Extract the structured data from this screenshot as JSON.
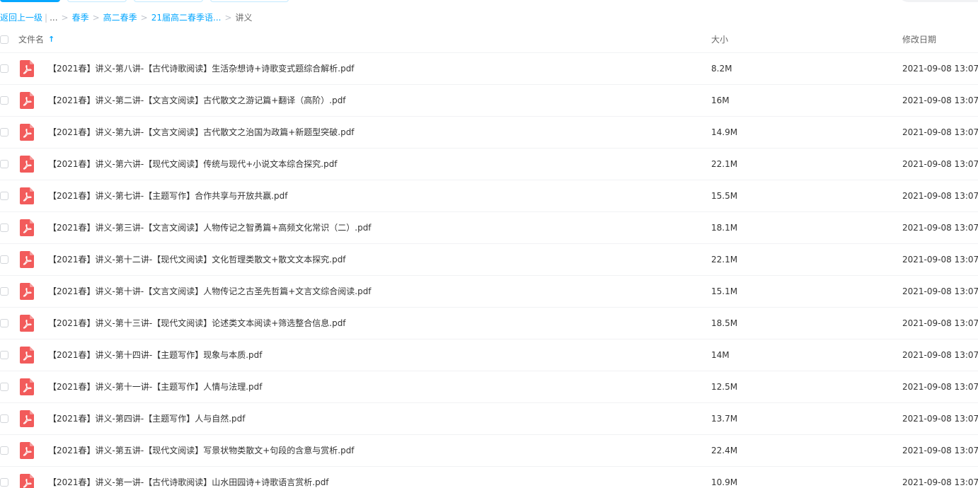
{
  "breadcrumb": {
    "back": "返回上一级",
    "ellipsis": "...",
    "items": [
      "春季",
      "高二春季",
      "21届高二春季语..."
    ],
    "current": "讲义"
  },
  "header": {
    "name": "文件名",
    "size": "大小",
    "date": "修改日期"
  },
  "colors": {
    "accent": "#06a7ff",
    "pdf_red": "#f25b5b"
  },
  "files": [
    {
      "name": "【2021春】讲义-第八讲-【古代诗歌阅读】生活杂想诗+诗歌变式题综合解析.pdf",
      "size": "8.2M",
      "date": "2021-09-08 13:07"
    },
    {
      "name": "【2021春】讲义-第二讲-【文言文阅读】古代散文之游记篇+翻译（高阶）.pdf",
      "size": "16M",
      "date": "2021-09-08 13:07"
    },
    {
      "name": "【2021春】讲义-第九讲-【文言文阅读】古代散文之治国为政篇+新题型突破.pdf",
      "size": "14.9M",
      "date": "2021-09-08 13:07"
    },
    {
      "name": "【2021春】讲义-第六讲-【现代文阅读】传统与现代+小说文本综合探究.pdf",
      "size": "22.1M",
      "date": "2021-09-08 13:07"
    },
    {
      "name": "【2021春】讲义-第七讲-【主题写作】合作共享与开放共赢.pdf",
      "size": "15.5M",
      "date": "2021-09-08 13:07"
    },
    {
      "name": "【2021春】讲义-第三讲-【文言文阅读】人物传记之智勇篇+高频文化常识（二）.pdf",
      "size": "18.1M",
      "date": "2021-09-08 13:07"
    },
    {
      "name": "【2021春】讲义-第十二讲-【现代文阅读】文化哲理类散文+散文文本探究.pdf",
      "size": "22.1M",
      "date": "2021-09-08 13:07"
    },
    {
      "name": "【2021春】讲义-第十讲-【文言文阅读】人物传记之古圣先哲篇+文言文综合阅读.pdf",
      "size": "15.1M",
      "date": "2021-09-08 13:07"
    },
    {
      "name": "【2021春】讲义-第十三讲-【现代文阅读】论述类文本阅读+筛选整合信息.pdf",
      "size": "18.5M",
      "date": "2021-09-08 13:07"
    },
    {
      "name": "【2021春】讲义-第十四讲-【主题写作】现象与本质.pdf",
      "size": "14M",
      "date": "2021-09-08 13:07"
    },
    {
      "name": "【2021春】讲义-第十一讲-【主题写作】人情与法理.pdf",
      "size": "12.5M",
      "date": "2021-09-08 13:07"
    },
    {
      "name": "【2021春】讲义-第四讲-【主题写作】人与自然.pdf",
      "size": "13.7M",
      "date": "2021-09-08 13:07"
    },
    {
      "name": "【2021春】讲义-第五讲-【现代文阅读】写景状物类散文+句段的含意与赏析.pdf",
      "size": "22.4M",
      "date": "2021-09-08 13:07"
    },
    {
      "name": "【2021春】讲义-第一讲-【古代诗歌阅读】山水田园诗+诗歌语言赏析.pdf",
      "size": "10.9M",
      "date": "2021-09-08 13:07"
    }
  ]
}
